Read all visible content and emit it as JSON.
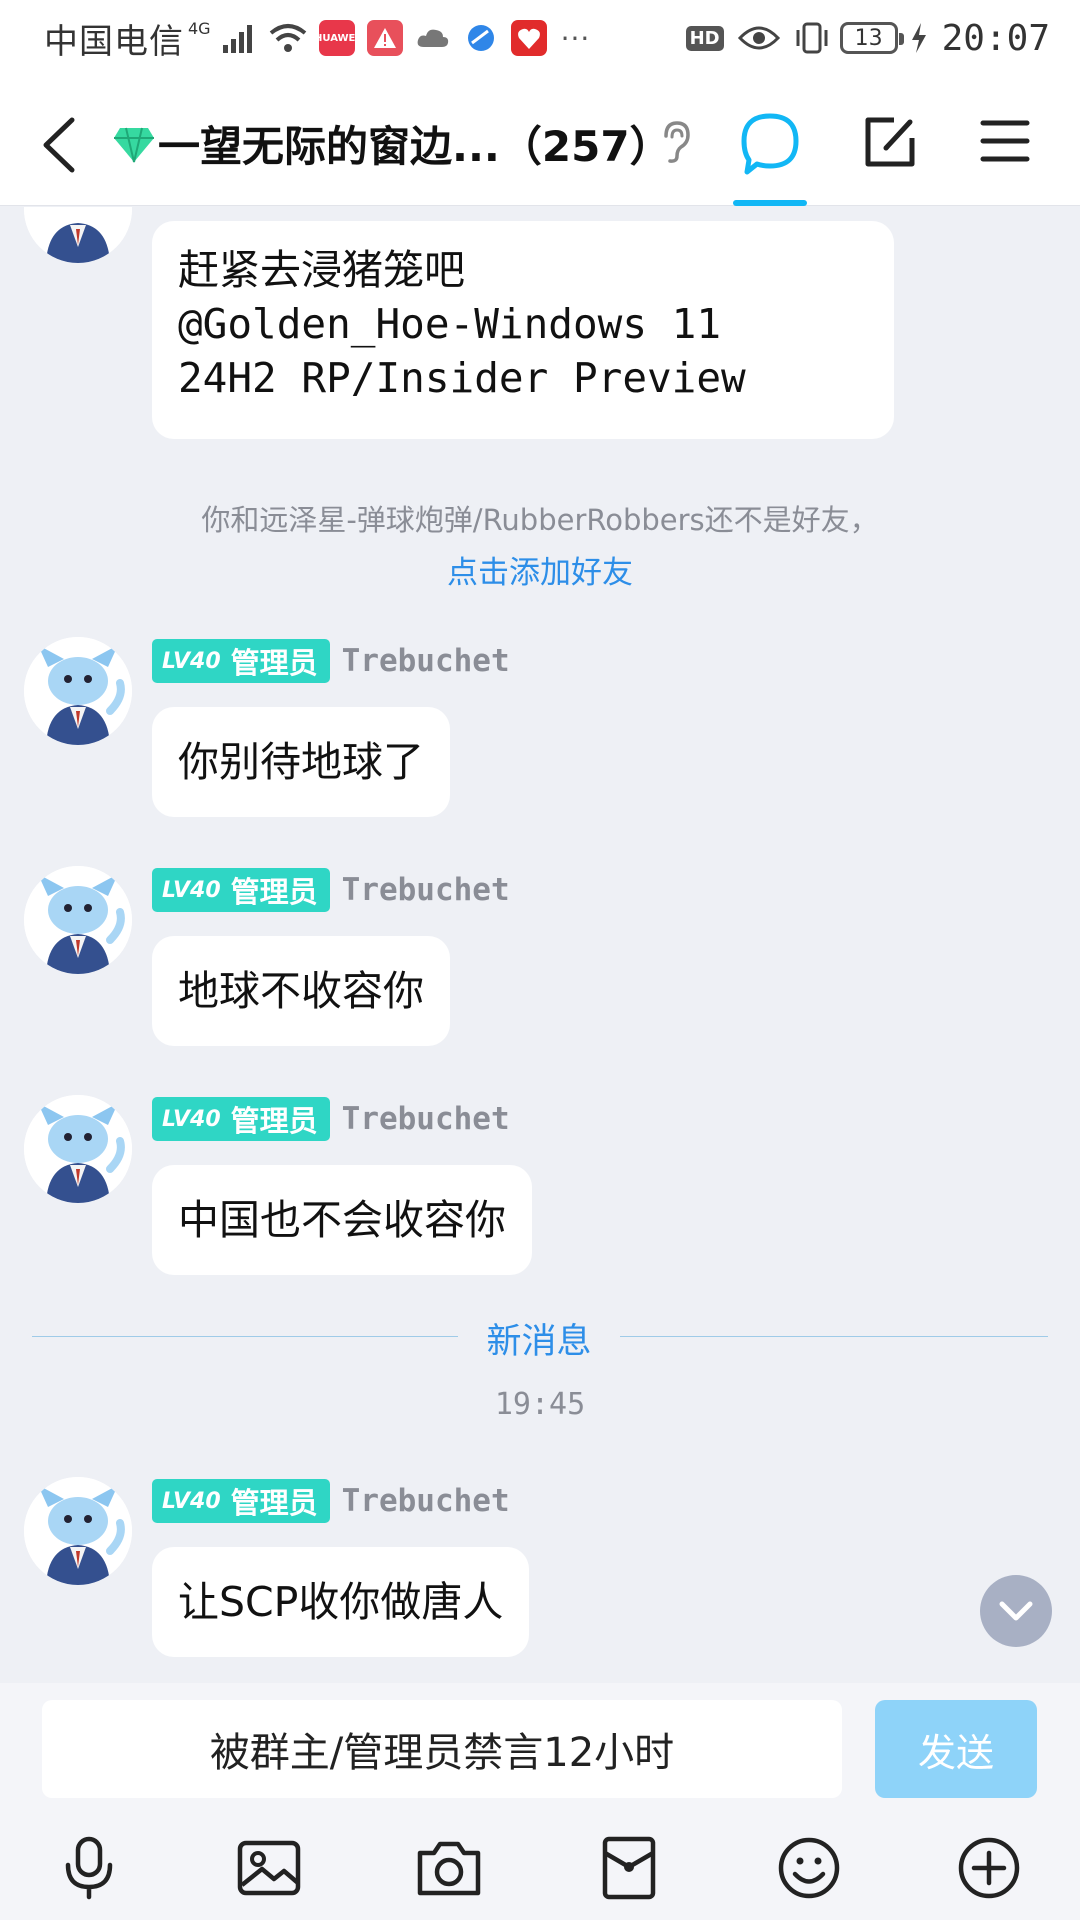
{
  "status_bar": {
    "carrier": "中国电信",
    "network": "4G",
    "hd": "HD",
    "battery": "13",
    "time": "20:07",
    "more": "···"
  },
  "header": {
    "title": "一望无际的窗边...（257）"
  },
  "messages": {
    "first": {
      "text": "赶紧去浸猪笼吧\n@Golden_Hoe-Windows 11\n24H2 RP/Insider Preview"
    },
    "notice": {
      "text": "你和远泽星-弹球炮弹/RubberRobbers还不是好友，",
      "link": "点击添加好友"
    },
    "items": [
      {
        "level": "LV40",
        "role": "管理员",
        "sender": "Trebuchet",
        "text": "你别待地球了"
      },
      {
        "level": "LV40",
        "role": "管理员",
        "sender": "Trebuchet",
        "text": "地球不收容你"
      },
      {
        "level": "LV40",
        "role": "管理员",
        "sender": "Trebuchet",
        "text": "中国也不会收容你"
      },
      {
        "level": "LV40",
        "role": "管理员",
        "sender": "Trebuchet",
        "text": "让SCP收你做唐人"
      }
    ],
    "new_divider": "新消息",
    "timestamp": "19:45"
  },
  "input": {
    "muted_text": "被群主/管理员禁言12小时",
    "send_label": "发送"
  },
  "colors": {
    "accent": "#12b7f5",
    "badge": "#2fd6c5",
    "link": "#2d8ee8",
    "send_disabled": "#8ed3f9",
    "chat_bg": "#eef0f5"
  },
  "icons": {
    "toolbar": [
      "microphone-icon",
      "image-icon",
      "camera-icon",
      "red-packet-icon",
      "emoji-icon",
      "plus-icon"
    ]
  }
}
